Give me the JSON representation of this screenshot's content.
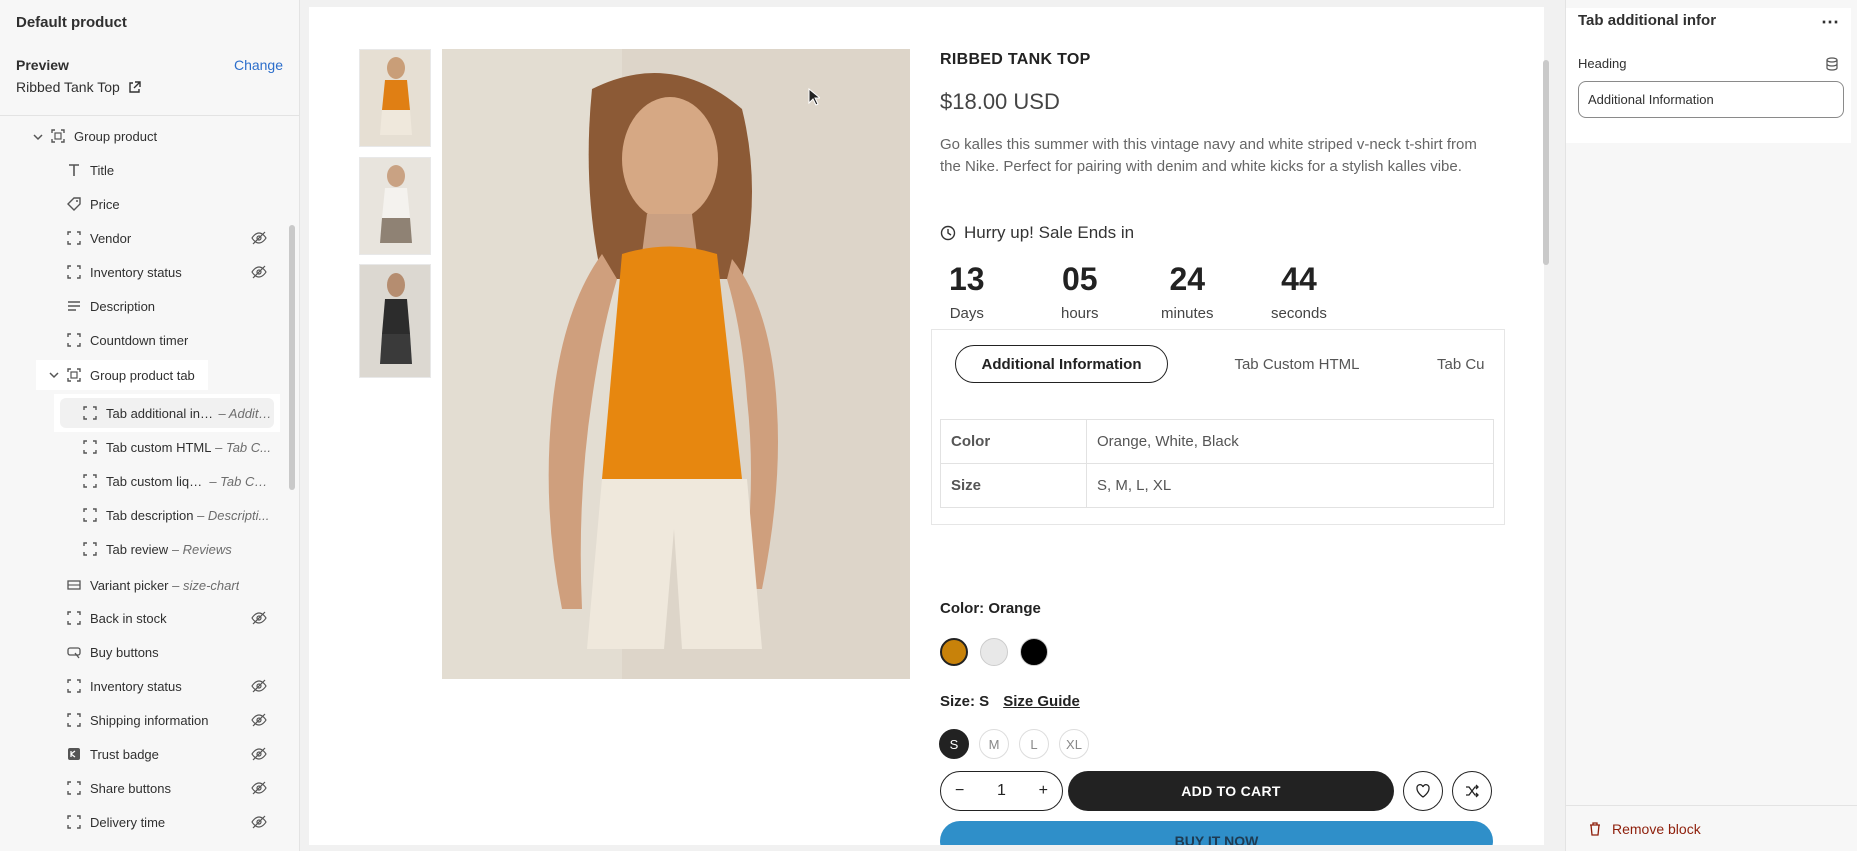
{
  "sidebar": {
    "title": "Default product",
    "preview_label": "Preview",
    "change_label": "Change",
    "product_name": "Ribbed Tank Top",
    "items": [
      {
        "label": "Group product",
        "sub": "",
        "hidden": false
      },
      {
        "label": "Title",
        "sub": "",
        "hidden": false
      },
      {
        "label": "Price",
        "sub": "",
        "hidden": false
      },
      {
        "label": "Vendor",
        "sub": "",
        "hidden": true
      },
      {
        "label": "Inventory status",
        "sub": "",
        "hidden": true
      },
      {
        "label": "Description",
        "sub": "",
        "hidden": false
      },
      {
        "label": "Countdown timer",
        "sub": "",
        "hidden": false
      },
      {
        "label": "Group product tab",
        "sub": "",
        "hidden": false
      },
      {
        "label": "Tab additional infor",
        "sub": "– Additi...",
        "hidden": false
      },
      {
        "label": "Tab custom HTML",
        "sub": "– Tab C...",
        "hidden": false
      },
      {
        "label": "Tab custom liquid",
        "sub": "– Tab Cu...",
        "hidden": false
      },
      {
        "label": "Tab description",
        "sub": "– Descripti...",
        "hidden": false
      },
      {
        "label": "Tab review",
        "sub": "– Reviews",
        "hidden": false
      },
      {
        "label": "Variant picker",
        "sub": "– size-chart",
        "hidden": false
      },
      {
        "label": "Back in stock",
        "sub": "",
        "hidden": true
      },
      {
        "label": "Buy buttons",
        "sub": "",
        "hidden": false
      },
      {
        "label": "Inventory status",
        "sub": "",
        "hidden": true
      },
      {
        "label": "Shipping information",
        "sub": "",
        "hidden": true
      },
      {
        "label": "Trust badge",
        "sub": "",
        "hidden": true
      },
      {
        "label": "Share buttons",
        "sub": "",
        "hidden": true
      },
      {
        "label": "Delivery time",
        "sub": "",
        "hidden": true
      }
    ]
  },
  "product": {
    "title": "RIBBED TANK TOP",
    "price": "$18.00 USD",
    "description": "Go kalles this summer with this vintage navy and white striped v-neck t-shirt from the Nike. Perfect for pairing with denim and white kicks for a stylish kalles vibe.",
    "hurry_text": "Hurry up! Sale Ends in",
    "countdown": [
      {
        "value": "13",
        "unit": "Days"
      },
      {
        "value": "05",
        "unit": "hours"
      },
      {
        "value": "24",
        "unit": "minutes"
      },
      {
        "value": "44",
        "unit": "seconds"
      }
    ],
    "tabs": [
      "Additional Information",
      "Tab Custom HTML",
      "Tab Cu"
    ],
    "attributes": [
      {
        "key": "Color",
        "value": "Orange, White, Black"
      },
      {
        "key": "Size",
        "value": "S, M, L, XL"
      }
    ],
    "color_label": "Color: Orange",
    "swatches": [
      "#c8820a",
      "#e8e8e8",
      "#000000"
    ],
    "size_label": "Size: S",
    "size_guide": "Size Guide",
    "sizes": [
      "S",
      "M",
      "L",
      "XL"
    ],
    "quantity": "1",
    "add_to_cart": "ADD TO CART",
    "buy_now": "BUY IT NOW"
  },
  "panel": {
    "title": "Tab additional infor",
    "heading_label": "Heading",
    "heading_value": "Additional Information",
    "remove_label": "Remove block"
  }
}
